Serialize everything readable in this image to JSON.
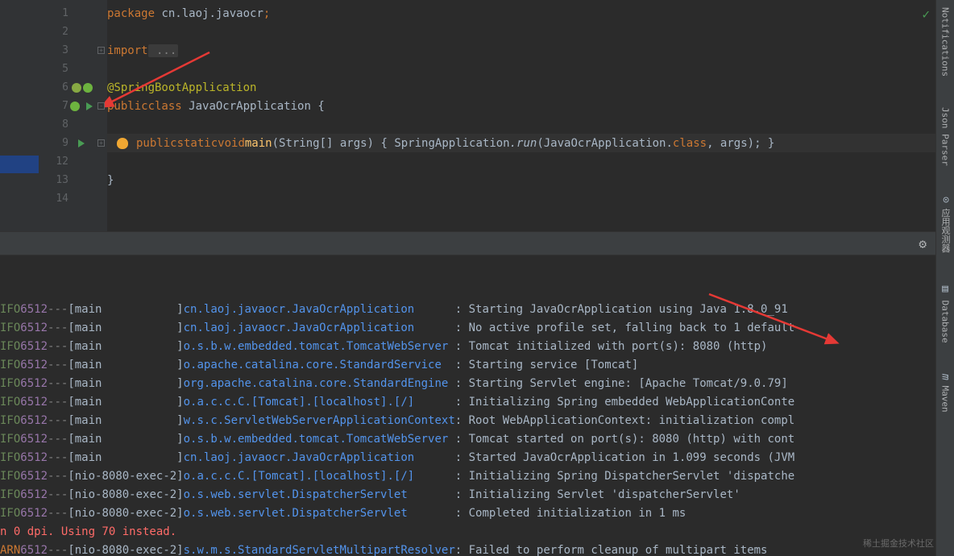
{
  "editor": {
    "lines": [
      "1",
      "2",
      "3",
      "5",
      "6",
      "7",
      "8",
      "9",
      "12",
      "13",
      "14"
    ],
    "package_kw": "package",
    "package_name": " cn.laoj.javaocr",
    "import_kw": "import",
    "import_fold": " ...",
    "annotation": "@SpringBootApplication",
    "public_kw": "public",
    "class_kw": "class",
    "class_name": " JavaOcrApplication ",
    "brace_open": "{",
    "static_kw": "static",
    "void_kw": "void",
    "main_method": "main",
    "main_params": "(String[] args) ",
    "main_body_open": "{ ",
    "spring_app": "SpringApplication",
    "run_mth": ".run",
    "run_args": "(JavaOcrApplication.",
    "class_ref": "class",
    "run_end": ", args); ",
    "brace_close": "}",
    "close_brace": "}"
  },
  "console": {
    "lines": [
      {
        "lv": "IFO",
        "pid": "6512",
        "th": "main",
        "lg": "cn.laoj.javaocr.JavaOcrApplication",
        "msg": "Starting JavaOcrApplication using Java 1.8.0_91"
      },
      {
        "lv": "IFO",
        "pid": "6512",
        "th": "main",
        "lg": "cn.laoj.javaocr.JavaOcrApplication",
        "msg": "No active profile set, falling back to 1 default"
      },
      {
        "lv": "IFO",
        "pid": "6512",
        "th": "main",
        "lg": "o.s.b.w.embedded.tomcat.TomcatWebServer",
        "msg": "Tomcat initialized with port(s): 8080 (http)"
      },
      {
        "lv": "IFO",
        "pid": "6512",
        "th": "main",
        "lg": "o.apache.catalina.core.StandardService",
        "msg": "Starting service [Tomcat]"
      },
      {
        "lv": "IFO",
        "pid": "6512",
        "th": "main",
        "lg": "org.apache.catalina.core.StandardEngine",
        "msg": "Starting Servlet engine: [Apache Tomcat/9.0.79]"
      },
      {
        "lv": "IFO",
        "pid": "6512",
        "th": "main",
        "lg": "o.a.c.c.C.[Tomcat].[localhost].[/]",
        "msg": "Initializing Spring embedded WebApplicationConte"
      },
      {
        "lv": "IFO",
        "pid": "6512",
        "th": "main",
        "lg": "w.s.c.ServletWebServerApplicationContext",
        "msg": "Root WebApplicationContext: initialization compl"
      },
      {
        "lv": "IFO",
        "pid": "6512",
        "th": "main",
        "lg": "o.s.b.w.embedded.tomcat.TomcatWebServer",
        "msg": "Tomcat started on port(s): 8080 (http) with cont"
      },
      {
        "lv": "IFO",
        "pid": "6512",
        "th": "main",
        "lg": "cn.laoj.javaocr.JavaOcrApplication",
        "msg": "Started JavaOcrApplication in 1.099 seconds (JVM"
      },
      {
        "lv": "IFO",
        "pid": "6512",
        "th": "nio-8080-exec-2",
        "lg": "o.a.c.c.C.[Tomcat].[localhost].[/]",
        "msg": "Initializing Spring DispatcherServlet 'dispatche"
      },
      {
        "lv": "IFO",
        "pid": "6512",
        "th": "nio-8080-exec-2",
        "lg": "o.s.web.servlet.DispatcherServlet",
        "msg": "Initializing Servlet 'dispatcherServlet'"
      },
      {
        "lv": "IFO",
        "pid": "6512",
        "th": "nio-8080-exec-2",
        "lg": "o.s.web.servlet.DispatcherServlet",
        "msg": "Completed initialization in 1 ms"
      }
    ],
    "err_line": "n 0 dpi. Using 70 instead.",
    "warn_line": {
      "lv": "ARN",
      "pid": "6512",
      "th": "nio-8080-exec-2",
      "lg": "s.w.m.s.StandardServletMultipartResolver",
      "msg": "Failed to perform cleanup of multipart items"
    }
  },
  "sidebar": {
    "notifications": "Notifications",
    "json_parser": "Json Parser",
    "database": "Database",
    "maven": "Maven"
  },
  "watermark": "稀土掘金技术社区"
}
